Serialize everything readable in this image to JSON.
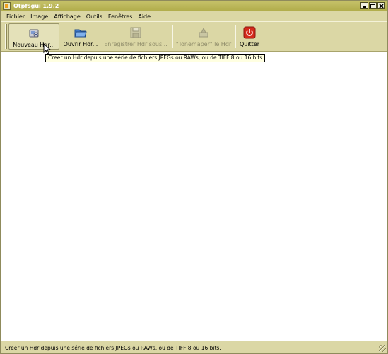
{
  "window": {
    "title": "Qtpfsgui 1.9.2"
  },
  "titlebar_buttons": [
    "minimize",
    "maximize",
    "close"
  ],
  "menu": [
    {
      "label": "Fichier"
    },
    {
      "label": "Image"
    },
    {
      "label": "Affichage"
    },
    {
      "label": "Outils"
    },
    {
      "label": "Fenêtres"
    },
    {
      "label": "Aide"
    }
  ],
  "toolbar": {
    "new_hdr": {
      "label": "Nouveau Hdr...",
      "icon": "new-hdr-icon",
      "enabled": true,
      "hover": true
    },
    "open_hdr": {
      "label": "Ouvrir Hdr...",
      "icon": "folder-open-icon",
      "enabled": true
    },
    "save_hdr": {
      "label": "Enregistrer Hdr sous...",
      "icon": "floppy-disk-icon",
      "enabled": false
    },
    "tonemap": {
      "label": "\"Tonemaper\" le Hdr",
      "icon": "tonemap-icon",
      "enabled": false
    },
    "quit": {
      "label": "Quitter",
      "icon": "power-icon",
      "enabled": true
    }
  },
  "tooltip": {
    "text": "Creer un Hdr depuis une série de fichiers JPEGs ou RAWs, ou de TIFF 8 ou 16 bits"
  },
  "statusbar": {
    "text": "Creer un Hdr depuis une série de fichiers JPEGs ou RAWs, ou de TIFF 8 ou 16 bits."
  },
  "colors": {
    "chrome": "#dbd7a5",
    "titlebar": "#b8b456",
    "tooltip_bg": "#ffffe1",
    "quit_red": "#d42a1c"
  }
}
